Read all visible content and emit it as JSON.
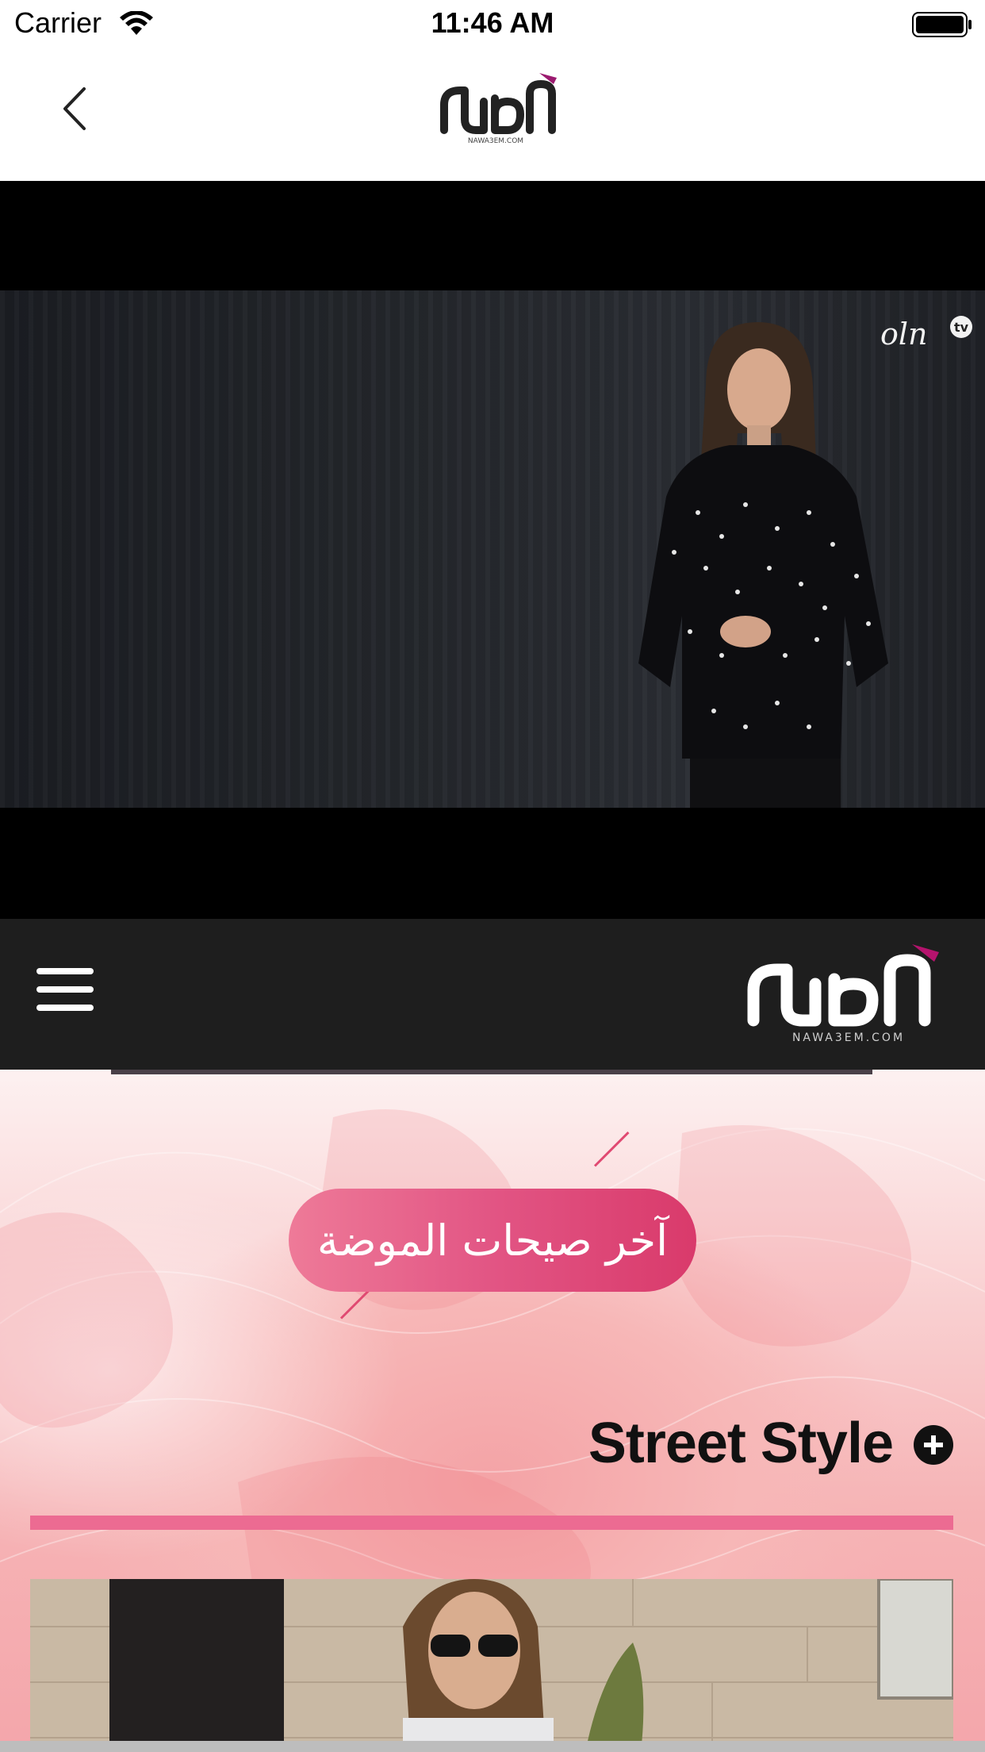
{
  "status_bar": {
    "carrier": "Carrier",
    "time": "11:46 AM"
  },
  "nav": {
    "brand": "نواعم",
    "brand_sub": "NAWA3EM.COM"
  },
  "video": {
    "channel_logo": "oln",
    "channel_badge": "tv"
  },
  "site_header": {
    "brand": "نواعم",
    "brand_sub": "NAWA3EM.COM"
  },
  "hero": {
    "badge": "آخر صيحات الموضة",
    "section_title": "Street Style"
  },
  "colors": {
    "accent_pink": "#ec6b92",
    "header_dark": "#1e1e1e",
    "pill_pink": "#e25584",
    "logo_purple": "#9b1a6f"
  },
  "icons": [
    "wifi-icon",
    "battery-icon",
    "back-chevron-icon",
    "hamburger-menu-icon",
    "plus-circle-icon"
  ]
}
